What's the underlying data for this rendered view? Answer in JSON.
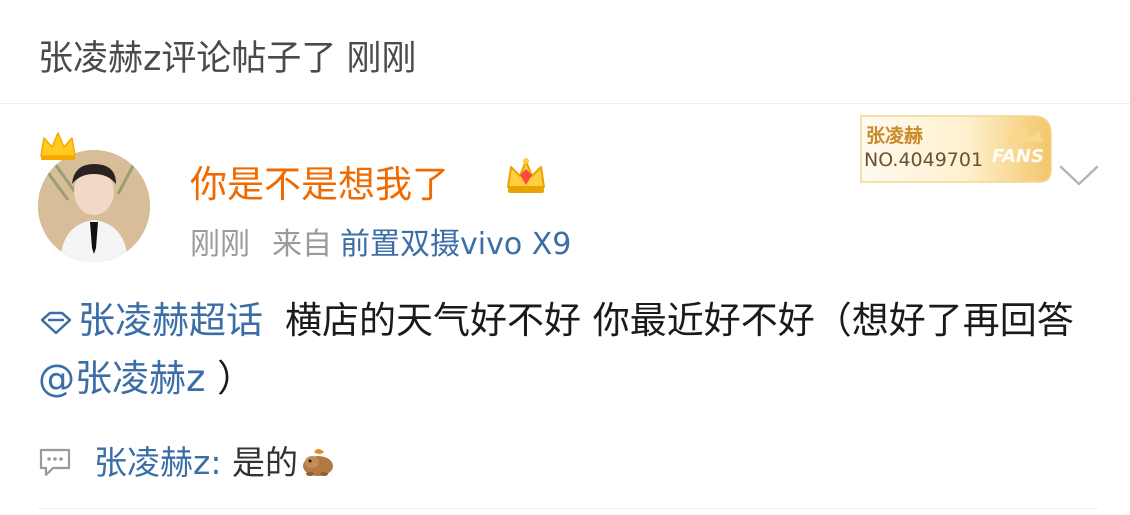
{
  "header": {
    "title": "张凌赫z评论帖子了",
    "time": "刚刚"
  },
  "post": {
    "username": "你是不是想我了",
    "time": "刚刚",
    "source_prefix": "来自",
    "device": "前置双摄vivo X9",
    "fans_badge": {
      "name": "张凌赫",
      "number": "NO.4049701",
      "label": "FANS"
    },
    "body": {
      "topic": "张凌赫超话",
      "text_1": "横店的天气好不好 你最近好不好（想好了再回答",
      "mention": "@张凌赫z",
      "text_2": " ）"
    }
  },
  "comment": {
    "author": "张凌赫z:",
    "text": "是的"
  },
  "icons": {
    "crown": "crown-icon",
    "vip": "vip-crown-icon",
    "chevron": "chevron-down-icon",
    "super_topic": "super-topic-icon",
    "comment": "comment-icon",
    "emoji": "capybara-emoji-icon"
  },
  "colors": {
    "username": "#f06a00",
    "link": "#3b6ea7",
    "meta": "#9a9a9a",
    "fans_gold": "#f3c66a"
  }
}
